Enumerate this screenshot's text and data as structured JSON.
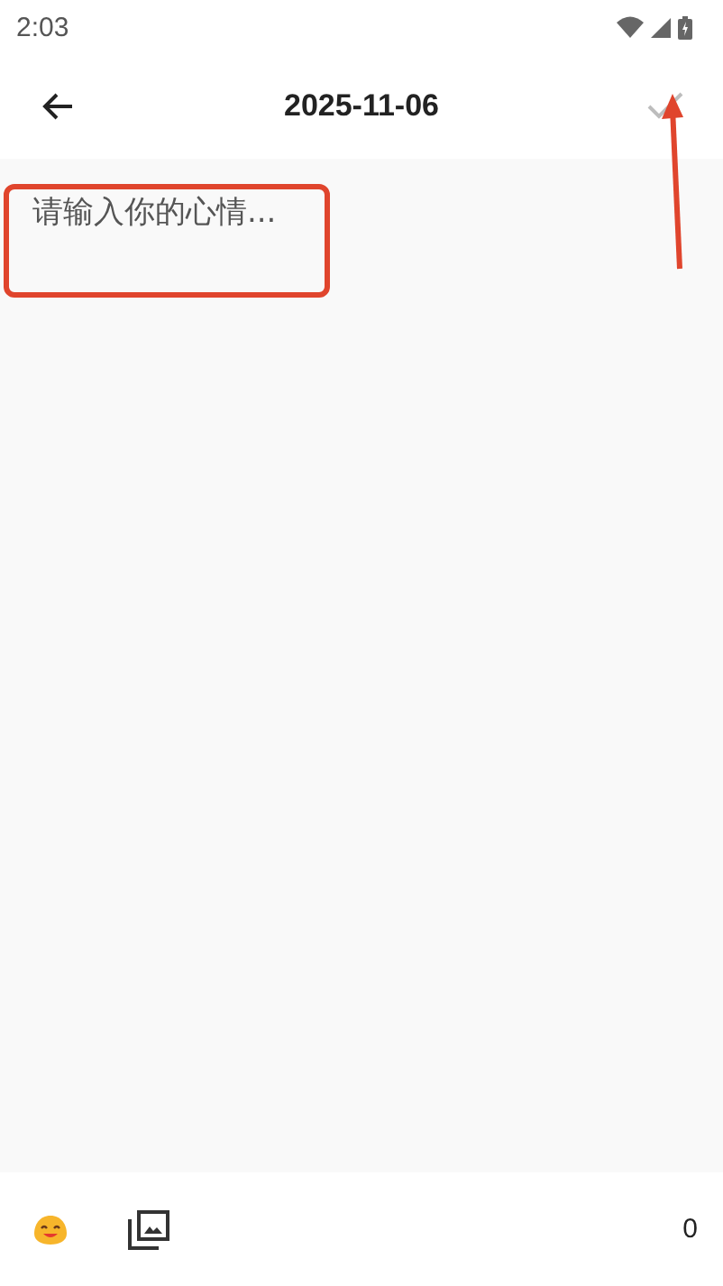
{
  "status_bar": {
    "time": "2:03"
  },
  "app_bar": {
    "title": "2025-11-06",
    "save_disabled": true
  },
  "editor": {
    "placeholder": "请输入你的心情..."
  },
  "bottom_bar": {
    "count": "0"
  }
}
